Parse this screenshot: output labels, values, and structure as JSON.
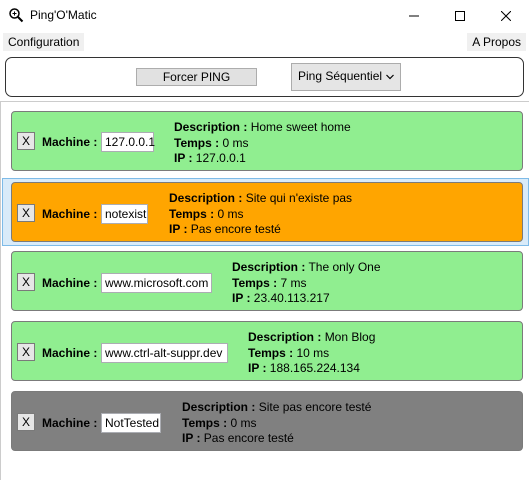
{
  "window": {
    "title": "Ping'O'Matic"
  },
  "menu": {
    "config": "Configuration",
    "about": "A Propos"
  },
  "toolbar": {
    "force_label": "Forcer PING",
    "mode_value": "Ping Séquentiel"
  },
  "labels": {
    "machine": "Machine :",
    "description": "Description :",
    "temps": "Temps :",
    "ip": "IP :",
    "remove": "X"
  },
  "colors": {
    "ok": "#90ee90",
    "error": "#ffa500",
    "untested": "#808080",
    "selection": "#d9ebf9"
  },
  "machines": [
    {
      "host": "127.0.0.1",
      "description": "Home sweet home",
      "temps": "0  ms",
      "ip": "127.0.0.1",
      "status": "ok"
    },
    {
      "host": "notexist",
      "description": "Site qui n'existe pas",
      "temps": "0  ms",
      "ip": "Pas encore testé",
      "status": "error"
    },
    {
      "host": "www.microsoft.com",
      "description": "The only One",
      "temps": "7  ms",
      "ip": "23.40.113.217",
      "status": "ok"
    },
    {
      "host": "www.ctrl-alt-suppr.dev",
      "description": "Mon Blog",
      "temps": "10  ms",
      "ip": "188.165.224.134",
      "status": "ok"
    },
    {
      "host": "NotTested",
      "description": "Site pas encore testé",
      "temps": "0  ms",
      "ip": "Pas encore testé",
      "status": "untested"
    }
  ]
}
